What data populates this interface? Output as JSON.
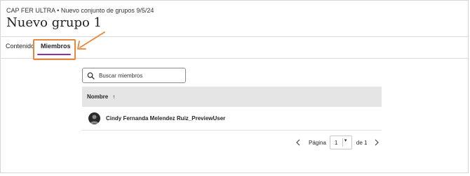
{
  "header": {
    "breadcrumb": "CAP FER ULTRA • Nuevo conjunto de grupos 9/5/24",
    "title": "Nuevo grupo 1"
  },
  "tabs": [
    {
      "label": "Contenido",
      "active": false
    },
    {
      "label": "Miembros",
      "active": true
    }
  ],
  "search": {
    "placeholder": "Buscar miembros",
    "value": ""
  },
  "table": {
    "columns": [
      {
        "label": "Nombre",
        "sort_icon": "↑"
      }
    ],
    "rows": [
      {
        "name": "Cindy Fernanda Melendez Ruiz_PreviewUser",
        "avatar_icon": "user-silhouette"
      }
    ]
  },
  "pagination": {
    "label": "Página",
    "current_page": "1",
    "of_label": "de 1",
    "caret": "▾"
  },
  "colors": {
    "active_tab_underline": "#8d2fa6",
    "highlight_annotation": "#e8863b",
    "table_header_bg": "#e5e5e5"
  }
}
